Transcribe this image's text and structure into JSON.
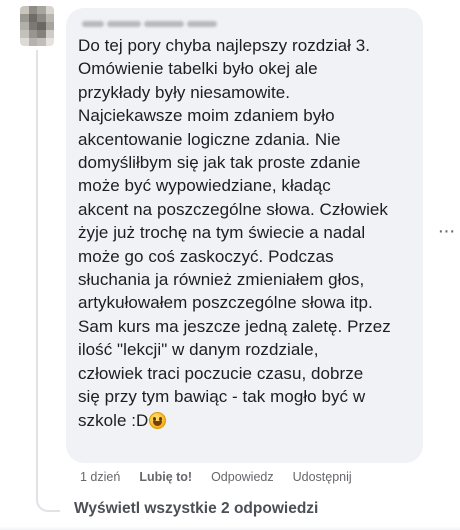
{
  "comment": {
    "text": "Do tej pory chyba najlepszy rozdział 3.\nOmówienie tabelki było okej ale\nprzykłady były niesamowite.\nNajciekawsze moim zdaniem było\nakcentowanie logiczne zdania. Nie\ndomyśliłbym się jak tak proste zdanie\nmoże być wypowiedziane, kładąc\nakcent na poszczególne słowa. Człowiek\nżyje już trochę na tym świecie a nadal\nmoże go coś zaskoczyć. Podczas\nsłuchania ja również zmieniałem głos,\nartykułowałem poszczególne słowa itp.\nSam kurs ma jeszcze jedną zaletę. Przez\nilość \"lekcji\" w danym rozdziale,\nczłowiek traci poczucie czasu, dobrze\nsię przy tym bawiąc - tak mogło być w\nszkole :D",
    "emoji": "grinning-sweat-emoji",
    "more_icon": "more-horizontal-icon",
    "more_glyph": "···"
  },
  "actions": {
    "time": "1 dzień",
    "like": "Lubię to!",
    "reply": "Odpowiedz",
    "share": "Udostępnij"
  },
  "replies": {
    "view_all": "Wyświetl wszystkie 2 odpowiedzi"
  },
  "colors": {
    "bubble_bg": "#f0f2f5",
    "meta_text": "#65676b"
  }
}
